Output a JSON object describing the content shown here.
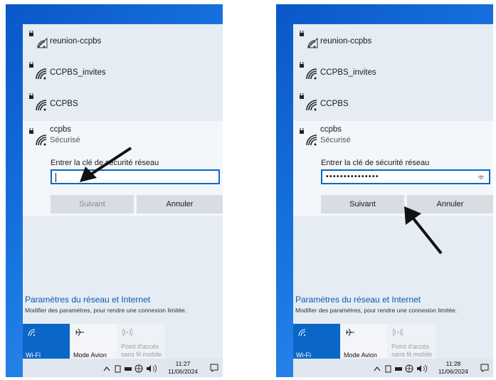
{
  "left_panel": {
    "networks": [
      "reunion-ccpbs",
      "CCPBS_invites",
      "CCPBS"
    ],
    "expanded_network": {
      "name": "ccpbs",
      "status": "Sécurisé"
    },
    "key_label": "Entrer la clé de sécurité réseau",
    "key_value": "",
    "next_label": "Suivant",
    "cancel_label": "Annuler",
    "settings_title": "Paramètres du réseau et Internet",
    "settings_sub": "Modifier des paramètres, pour rendre une connexion limitée.",
    "tiles": {
      "wifi": "Wi-Fi",
      "plane": "Mode Avion",
      "hotspot_l1": "Point d'accès",
      "hotspot_l2": "sans fil mobile"
    },
    "time": "11:27",
    "date": "11/06/2024"
  },
  "right_panel": {
    "networks": [
      "reunion-ccpbs",
      "CCPBS_invites",
      "CCPBS"
    ],
    "expanded_network": {
      "name": "ccpbs",
      "status": "Sécurisé"
    },
    "key_label": "Entrer la clé de sécurité réseau",
    "key_value": "•••••••••••••••",
    "next_label": "Suivant",
    "cancel_label": "Annuler",
    "settings_title": "Paramètres du réseau et Internet",
    "settings_sub": "Modifier des paramètres, pour rendre une connexion limitée.",
    "tiles": {
      "wifi": "Wi-Fi",
      "plane": "Mode Avion",
      "hotspot_l1": "Point d'accès",
      "hotspot_l2": "sans fil mobile"
    },
    "time": "11:28",
    "date": "11/06/2024"
  },
  "colors": {
    "accent": "#0b67c7",
    "link": "#0b57b5",
    "desktop": "#1874e0"
  },
  "icons": [
    "lock-wifi-icon",
    "eye-icon",
    "airplane-icon",
    "hotspot-icon",
    "chevron-up-icon",
    "notification-icon",
    "arrow-pointer"
  ]
}
